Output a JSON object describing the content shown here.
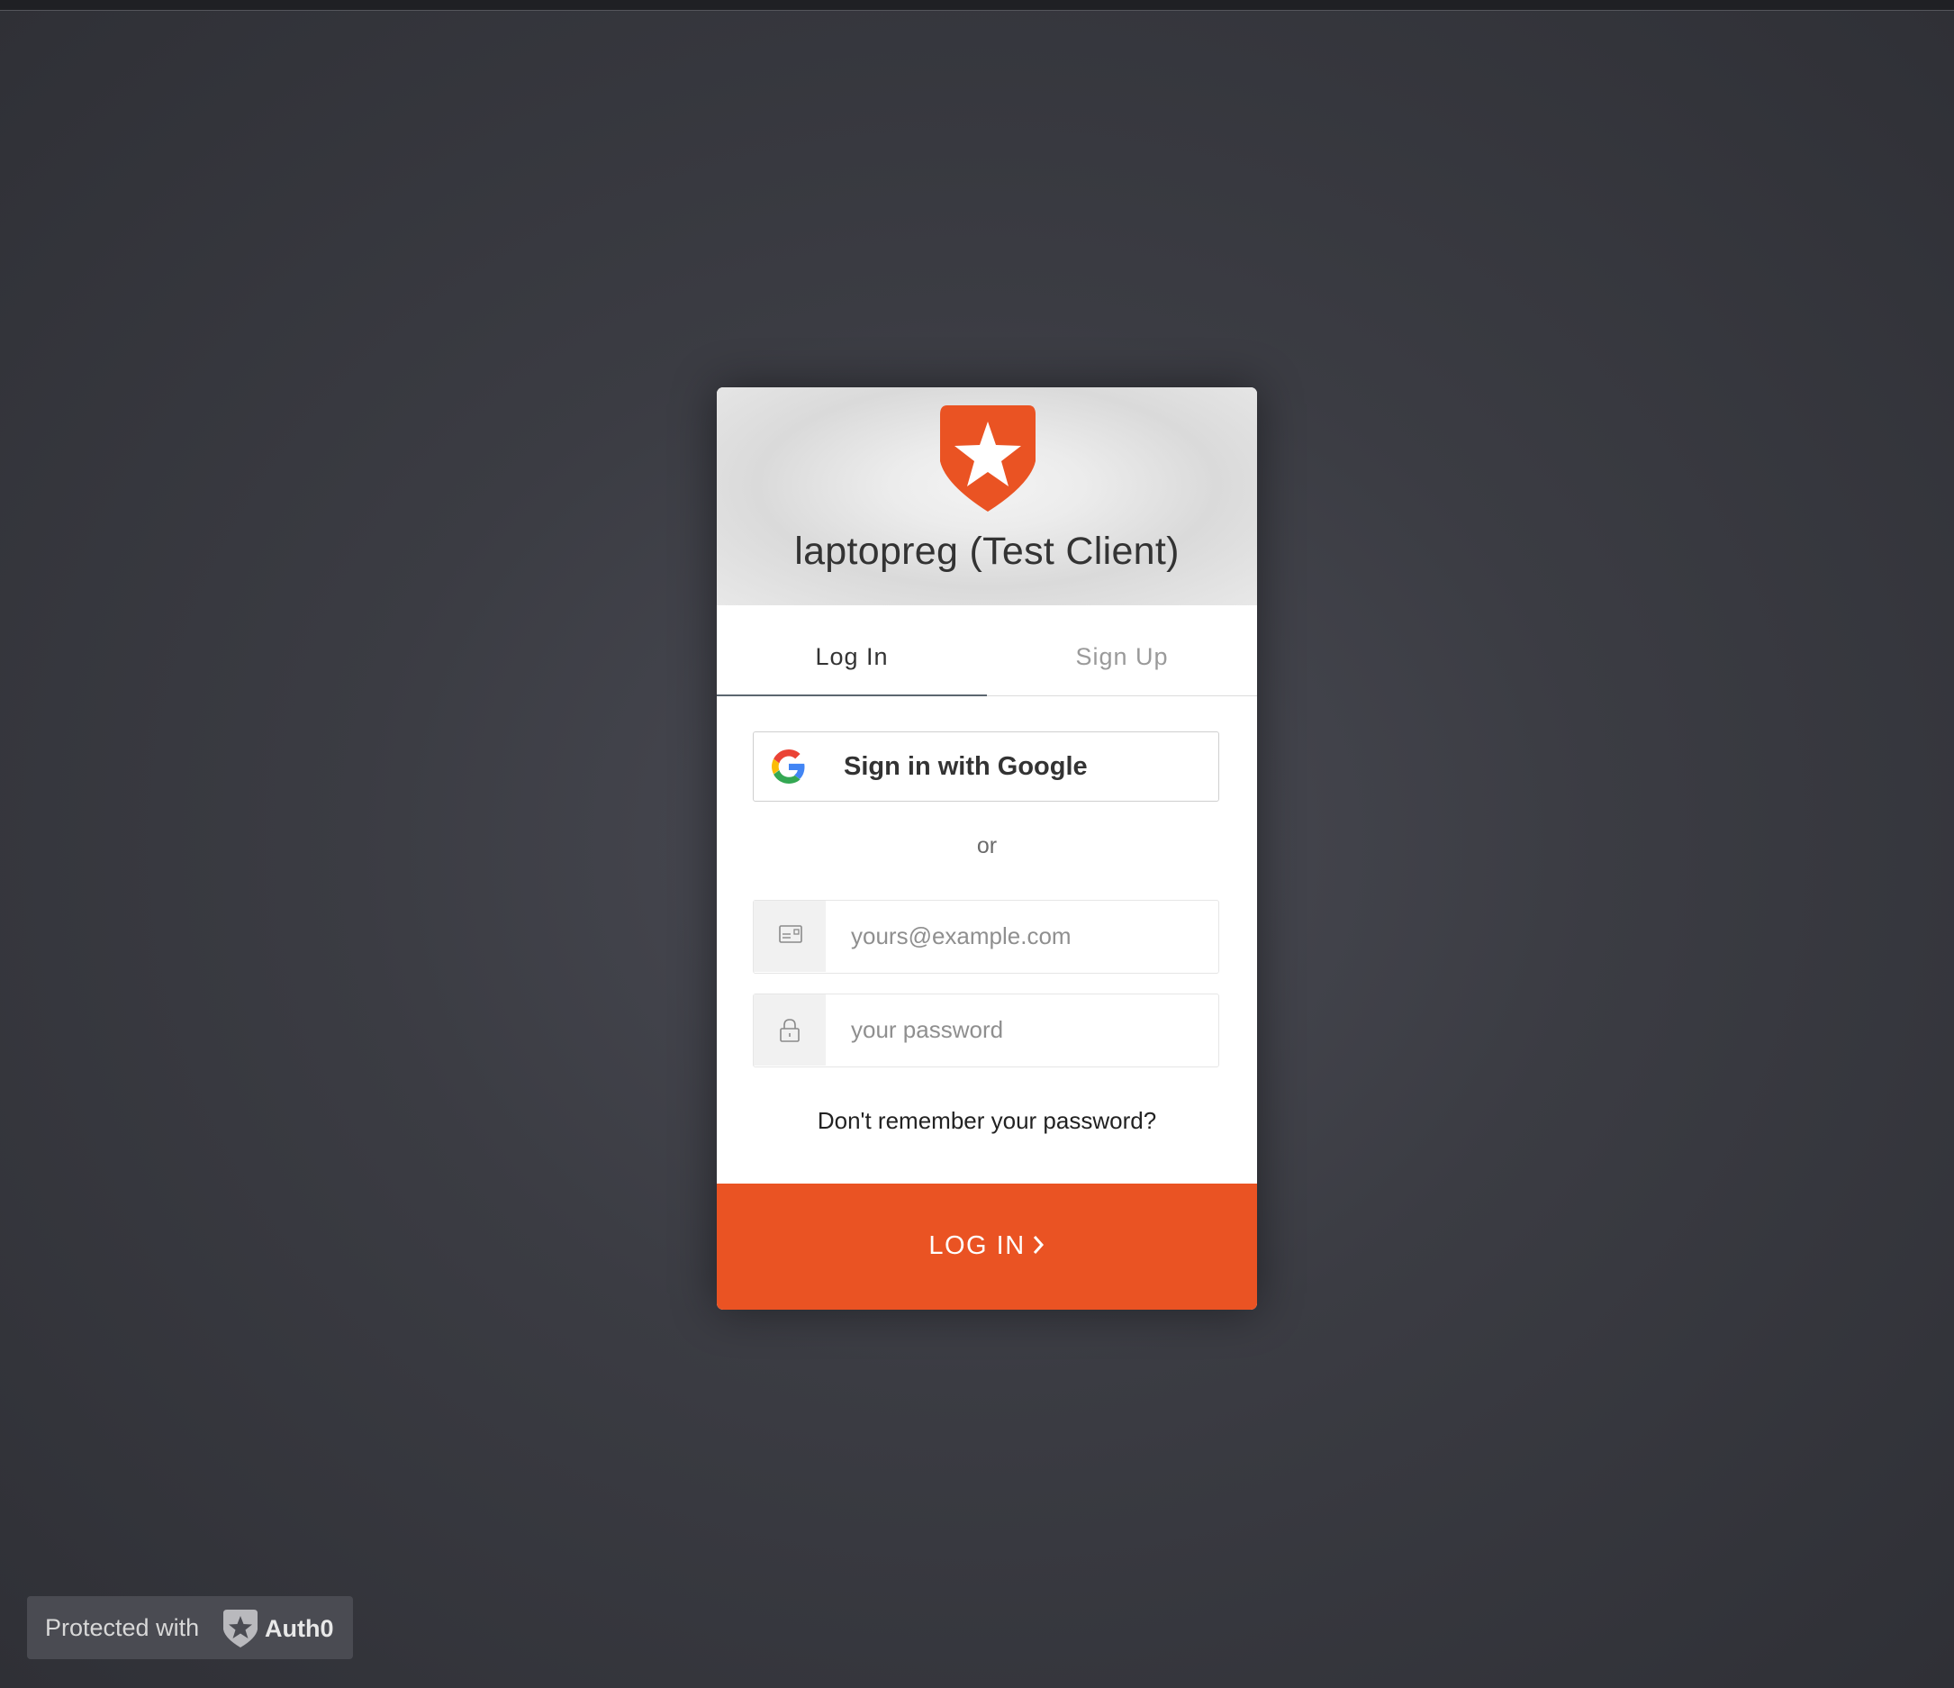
{
  "app": {
    "title": "laptopreg (Test Client)",
    "accent_color": "#ea5323",
    "logo_icon": "auth0-shield-star-icon"
  },
  "tabs": [
    {
      "label": "Log In",
      "active": true
    },
    {
      "label": "Sign Up",
      "active": false
    }
  ],
  "social": {
    "google_label": "Sign in with Google",
    "google_icon": "google-g-icon"
  },
  "divider": {
    "or_text": "or"
  },
  "form": {
    "email": {
      "value": "",
      "placeholder": "yours@example.com",
      "icon": "envelope-icon"
    },
    "password": {
      "value": "",
      "placeholder": "your password",
      "icon": "lock-icon"
    },
    "forgot_label": "Don't remember your password?",
    "submit_label": "LOG IN"
  },
  "badge": {
    "prefix": "Protected with",
    "brand": "Auth0"
  }
}
